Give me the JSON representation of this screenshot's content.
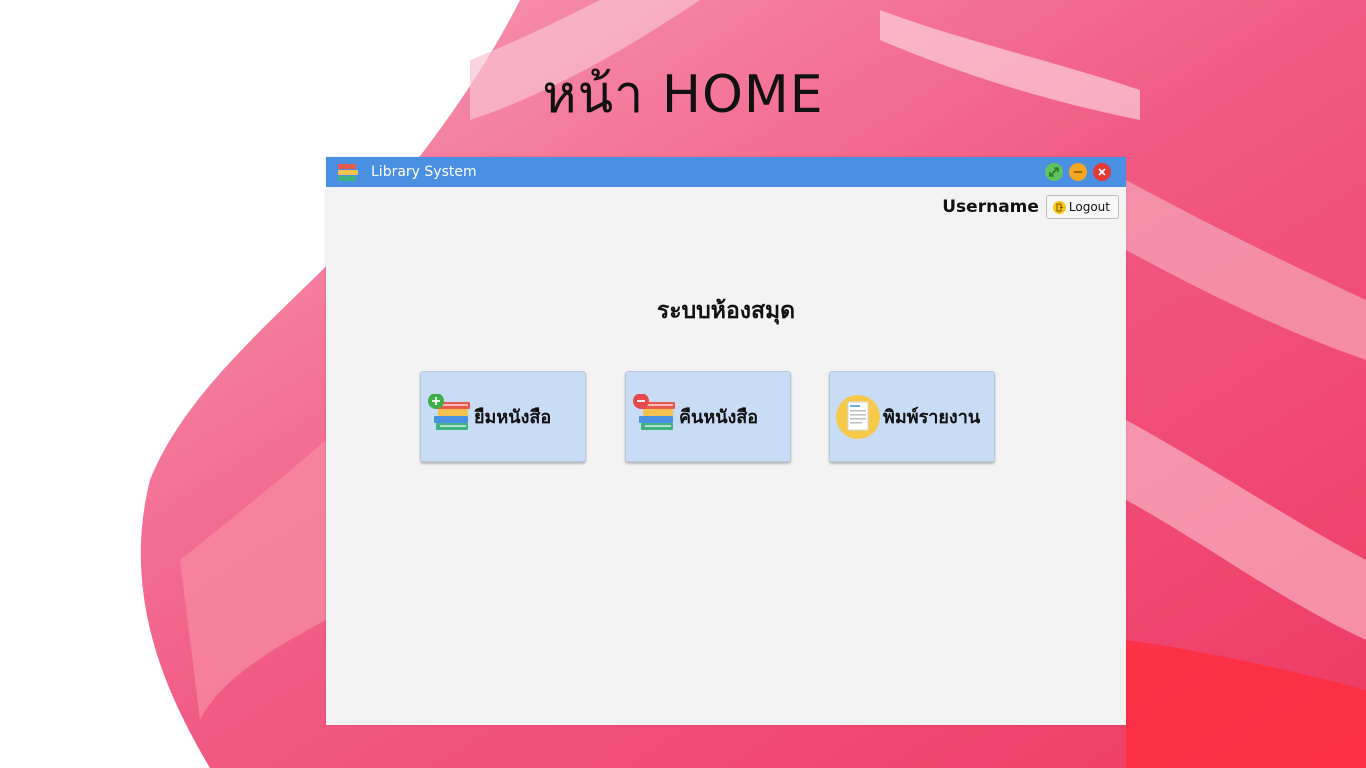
{
  "slide": {
    "title": "หน้า HOME"
  },
  "window": {
    "title": "Library System",
    "controls": [
      "maximize-icon",
      "minimize-icon",
      "close-icon"
    ]
  },
  "user": {
    "name": "Username",
    "logout_label": "Logout"
  },
  "main": {
    "heading": "ระบบห้องสมุด",
    "buttons": [
      {
        "label": "ยืมหนังสือ",
        "icon": "borrow-books-icon"
      },
      {
        "label": "คืนหนังสือ",
        "icon": "return-books-icon"
      },
      {
        "label": "พิมพ์รายงาน",
        "icon": "report-icon"
      }
    ]
  },
  "colors": {
    "titlebar": "#4a90e2",
    "window_bg": "#f3f3f3",
    "button_bg": "#c9dcf5",
    "background_paint": "#f0507a"
  }
}
